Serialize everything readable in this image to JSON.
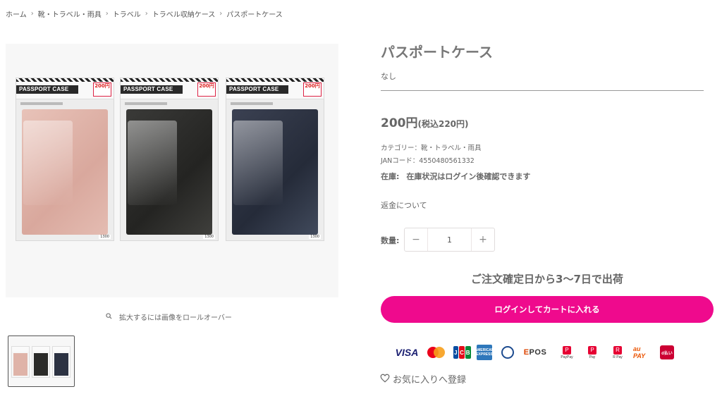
{
  "breadcrumb": {
    "items": [
      "ホーム",
      "靴・トラベル・雨具",
      "トラベル",
      "トラベル収納ケース"
    ],
    "current": "パスポートケース",
    "separator": "›"
  },
  "product_image": {
    "package_title": "PASSPORT CASE",
    "package_price": "200円",
    "colors": [
      "#dfb3a8",
      "#2b2b29",
      "#2c3242"
    ],
    "zoom_hint": "拡大するには画像をロールオーバー",
    "zoom_icon": "magnifier-icon"
  },
  "product": {
    "title": "パスポートケース",
    "variant": "なし",
    "price_main": "200円",
    "price_tax": "(税込220円)",
    "category_label": "カテゴリー：",
    "category": "靴・トラベル・雨具",
    "jan_label": "JANコード：",
    "jan": "4550480561332",
    "stock_label": "在庫:",
    "stock_text": "在庫状況はログイン後確認できます",
    "refund_link": "返金について"
  },
  "quantity": {
    "label": "数量:",
    "minus": "−",
    "plus": "+",
    "value": "1"
  },
  "shipping_text": "ご注文確定日から3〜7日で出荷",
  "cart_button": {
    "label": "ログインしてカートに入れる",
    "color": "#ef0a8d"
  },
  "payments": {
    "visa": "VISA",
    "jcb": [
      "J",
      "C",
      "B"
    ],
    "amex": "AMERICAN EXPRESS",
    "epos_e": "E",
    "epos_rest": "POS",
    "paypay_label": "PayPay",
    "paypay2_label": "Pay",
    "rpay_label": "R Pay",
    "aupay": "au PAY",
    "dbarai": "d払い"
  },
  "favorite": {
    "icon": "heart-outline-icon",
    "label": "お気に入りへ登録"
  }
}
